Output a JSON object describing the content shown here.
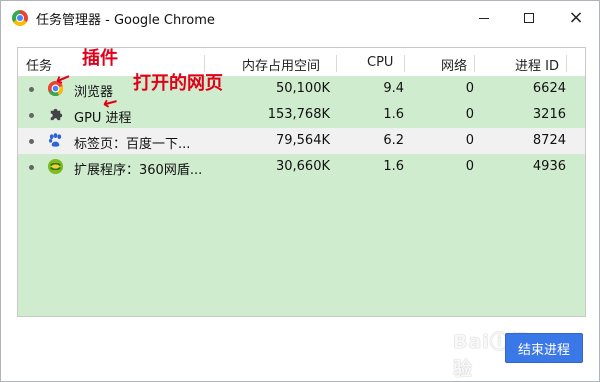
{
  "window": {
    "title": "任务管理器 - Google Chrome",
    "controls": {
      "minimize": "─",
      "maximize": "□",
      "close": "×"
    }
  },
  "columns": [
    "任务",
    "内存占用空间",
    "CPU",
    "网络",
    "进程 ID"
  ],
  "rows": [
    {
      "icon": "chrome-icon",
      "name": "浏览器",
      "memory": "50,100K",
      "cpu": "9.4",
      "network": "0",
      "pid": "6624"
    },
    {
      "icon": "puzzle-icon",
      "name": "GPU 进程",
      "memory": "153,768K",
      "cpu": "1.6",
      "network": "0",
      "pid": "3216"
    },
    {
      "icon": "baidu-paw-icon",
      "name": "标签页：百度一下...",
      "memory": "79,564K",
      "cpu": "6.2",
      "network": "0",
      "pid": "8724"
    },
    {
      "icon": "360-icon",
      "name": "扩展程序：360网盾...",
      "memory": "30,660K",
      "cpu": "1.6",
      "network": "0",
      "pid": "4936"
    }
  ],
  "annotations": {
    "plugin": "插件",
    "opened_page": "打开的网页"
  },
  "watermark": "Baiⓘ经验",
  "button": {
    "end_process": "结束进程"
  },
  "colors": {
    "row_green": "#cfeccf",
    "selected_row": "#f1f1f1",
    "button_blue": "#3b78e7",
    "annotation_red": "#e1001a"
  }
}
